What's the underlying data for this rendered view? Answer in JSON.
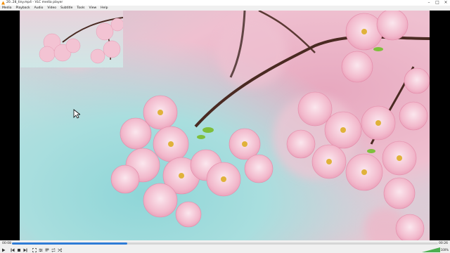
{
  "window": {
    "title": "20..28_tiny.mp4 - VLC media player",
    "controls": [
      "minimize-icon",
      "maximize-icon",
      "close-icon"
    ]
  },
  "menu": {
    "items": [
      "Media",
      "Playback",
      "Audio",
      "Video",
      "Subtitle",
      "Tools",
      "View",
      "Help"
    ]
  },
  "seek": {
    "elapsed": "00:08",
    "total": "00:26",
    "progress": 0.27
  },
  "controls": {
    "icons": [
      "play-icon",
      "stop-icon",
      "previous-icon",
      "next-icon",
      "fullscreen-icon",
      "extended-settings-icon",
      "playlist-icon",
      "loop-icon",
      "shuffle-icon"
    ]
  },
  "volume": {
    "level": 1.0,
    "label": "100%"
  },
  "colors": {
    "accent": "#2e7cd6",
    "volume": "#4caf50"
  }
}
